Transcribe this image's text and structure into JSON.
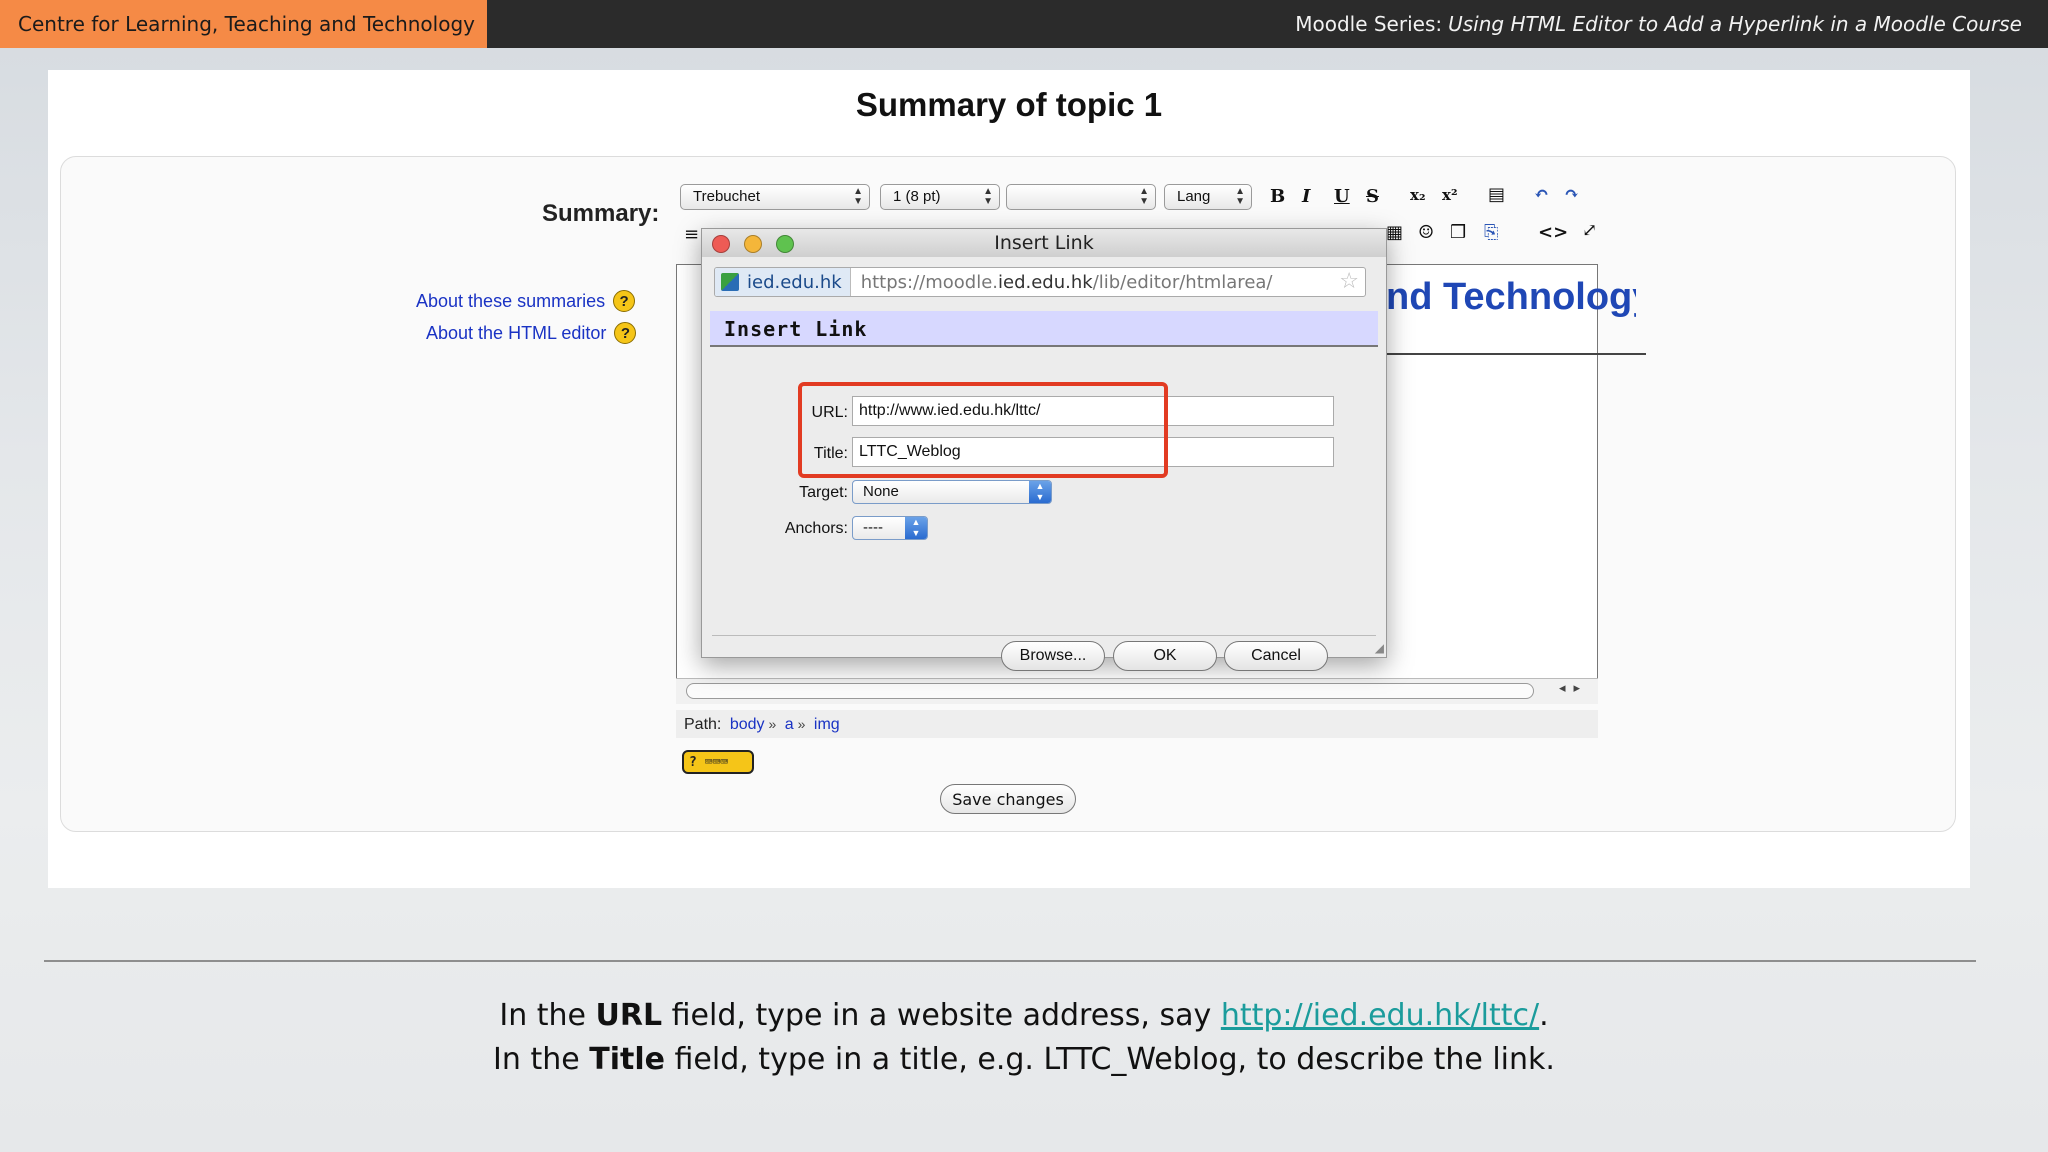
{
  "banner": {
    "org": "Centre for Learning, Teaching and Technology",
    "series_prefix": "Moodle Series:",
    "series_title": "Using HTML Editor to Add a Hyperlink in a Moodle Course"
  },
  "page": {
    "title": "Summary of topic 1",
    "summary_label": "Summary:",
    "help_links": [
      "About these summaries",
      "About the HTML editor"
    ]
  },
  "editor": {
    "font_select": "Trebuchet",
    "size_select": "1 (8 pt)",
    "style_select": "",
    "lang_select": "Lang",
    "content_heading": "nd Technology",
    "path_label": "Path:",
    "path_items": [
      "body",
      "a",
      "img"
    ],
    "save_label": "Save changes"
  },
  "dialog": {
    "window_title": "Insert Link",
    "site": "ied.edu.hk",
    "url_path_prefix": "https://moodle.",
    "url_path_domain": "ied.edu.hk",
    "url_path_suffix": "/lib/editor/htmlarea/",
    "header": "Insert Link",
    "url_label": "URL:",
    "url_value": "http://www.ied.edu.hk/lttc/",
    "title_label": "Title:",
    "title_value": "LTTC_Weblog",
    "target_label": "Target:",
    "target_value": "None",
    "anchors_label": "Anchors:",
    "anchors_value": "----",
    "browse_label": "Browse...",
    "ok_label": "OK",
    "cancel_label": "Cancel"
  },
  "caption": {
    "line1_pre": "In the",
    "line1_bold": "URL",
    "line1_mid": "field, type in a website address, say",
    "line1_link": "http://ied.edu.hk/lttc/",
    "line1_end": ".",
    "line2_pre": "In the",
    "line2_bold": "Title",
    "line2_rest": "field, type in a title, e.g. LTTC_Weblog, to describe the link."
  },
  "colors": {
    "banner_accent": "#f58a46",
    "highlight": "#e23b22",
    "link": "#1a33c4",
    "caption_link": "#1b9c9c"
  }
}
